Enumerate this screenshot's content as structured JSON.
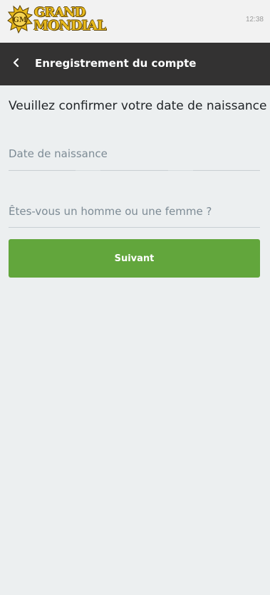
{
  "status_bar": {
    "time": "12:38"
  },
  "brand": {
    "line1": "GRAND",
    "line2": "MONDIAL",
    "monogram": "GM",
    "gold": "#e7b91c"
  },
  "header": {
    "title": "Enregistrement du compte",
    "back_icon": "chevron-left-icon",
    "background": "#333232"
  },
  "form": {
    "heading": "Veuillez confirmer votre date de naissance",
    "dob_placeholder": "Date de naissance",
    "gender_placeholder": "Êtes-vous un homme ou une femme ?",
    "submit_label": "Suivant",
    "submit_color": "#62a63c"
  }
}
